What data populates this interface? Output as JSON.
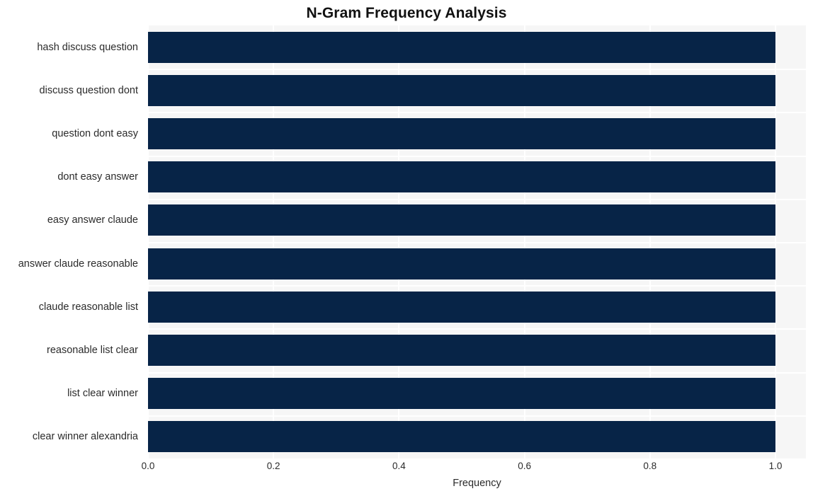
{
  "chart_data": {
    "type": "bar",
    "orientation": "horizontal",
    "title": "N-Gram Frequency Analysis",
    "xlabel": "Frequency",
    "ylabel": "",
    "xlim": [
      0.0,
      1.0
    ],
    "xticks": [
      "0.0",
      "0.2",
      "0.4",
      "0.6",
      "0.8",
      "1.0"
    ],
    "xtick_values": [
      0.0,
      0.2,
      0.4,
      0.6,
      0.8,
      1.0
    ],
    "grid": true,
    "legend": "none",
    "bar_color": "#072447",
    "plot_background": "#f6f6f6",
    "gridline_color": "#ffffff",
    "categories": [
      "hash discuss question",
      "discuss question dont",
      "question dont easy",
      "dont easy answer",
      "easy answer claude",
      "answer claude reasonable",
      "claude reasonable list",
      "reasonable list clear",
      "list clear winner",
      "clear winner alexandria"
    ],
    "values": [
      1.0,
      1.0,
      1.0,
      1.0,
      1.0,
      1.0,
      1.0,
      1.0,
      1.0,
      1.0
    ]
  }
}
